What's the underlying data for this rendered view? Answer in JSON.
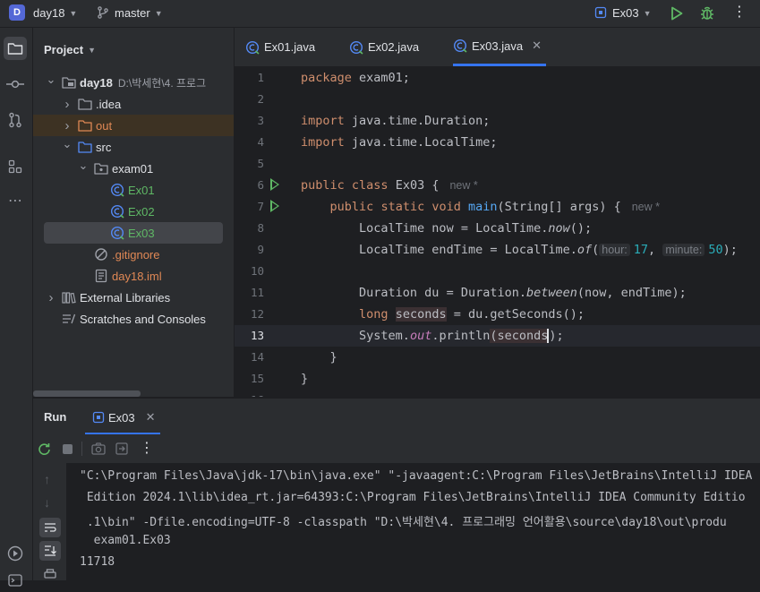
{
  "titlebar": {
    "project_badge": "D",
    "project_name": "day18",
    "branch": "master",
    "run_config": "Ex03"
  },
  "project_panel": {
    "title": "Project",
    "tree": [
      {
        "label": "day18",
        "suffix": "D:\\박세현\\4. 프로그",
        "icon": "module-folder-icon",
        "arrow": "down",
        "indent": 0
      },
      {
        "label": ".idea",
        "icon": "folder-icon",
        "arrow": "right",
        "indent": 1
      },
      {
        "label": "out",
        "icon": "folder-orange-icon",
        "arrow": "right",
        "indent": 1
      },
      {
        "label": "src",
        "icon": "source-folder-icon",
        "arrow": "down",
        "indent": 1
      },
      {
        "label": "exam01",
        "icon": "package-icon",
        "arrow": "down",
        "indent": 2
      },
      {
        "label": "Ex01",
        "icon": "java-class-icon",
        "arrow": "",
        "indent": 3
      },
      {
        "label": "Ex02",
        "icon": "java-class-icon",
        "arrow": "",
        "indent": 3
      },
      {
        "label": "Ex03",
        "icon": "java-class-icon",
        "arrow": "",
        "indent": 3
      },
      {
        "label": ".gitignore",
        "icon": "ignore-file-icon",
        "arrow": "",
        "indent": 2
      },
      {
        "label": "day18.iml",
        "icon": "iml-file-icon",
        "arrow": "",
        "indent": 2
      },
      {
        "label": "External Libraries",
        "icon": "library-icon",
        "arrow": "right",
        "indent": 0
      },
      {
        "label": "Scratches and Consoles",
        "icon": "scratches-icon",
        "arrow": "",
        "indent": 0
      }
    ]
  },
  "editor": {
    "tabs": [
      {
        "label": "Ex01.java",
        "active": false
      },
      {
        "label": "Ex02.java",
        "active": false
      },
      {
        "label": "Ex03.java",
        "active": true
      }
    ],
    "line_numbers": [
      "1",
      "2",
      "3",
      "4",
      "5",
      "6",
      "7",
      "8",
      "9",
      "10",
      "11",
      "12",
      "13",
      "14",
      "15",
      "16"
    ],
    "tokens": {
      "package_kw": "package",
      "package_name": " exam01;",
      "import_kw": "import",
      "import1": " java.time.Duration;",
      "import2": " java.time.LocalTime;",
      "public_kw": "public",
      "class_kw": "class",
      "class_name": "Ex03 {",
      "static_kw": "static",
      "void_kw": "void",
      "main_fn": "main",
      "main_params": "(String[] args) {",
      "new_marker": "new *",
      "line8_a": "LocalTime now = LocalTime.",
      "now_fn": "now",
      "line8_b": "();",
      "line9_a": "LocalTime endTime = LocalTime.",
      "of_fn": "of",
      "paren_open": "(",
      "hint_hour": "hour:",
      "hour_val": "17",
      "comma": ", ",
      "hint_minute": "minute:",
      "minute_val": "50",
      "line9_end": ");",
      "line11_a": "Duration du = Duration.",
      "between_fn": "between",
      "line11_b": "(now, endTime);",
      "long_kw": "long",
      "seconds_var": "seconds",
      "line12_b": " = du.getSeconds();",
      "line13_a": "System.",
      "out_field": "out",
      "line13_b": ".println",
      "line13_c": "(seconds",
      "line13_d": ");",
      "close_brace": "}"
    }
  },
  "run_panel": {
    "title": "Run",
    "tab": "Ex03",
    "output": [
      "\"C:\\Program Files\\Java\\jdk-17\\bin\\java.exe\" \"-javaagent:C:\\Program Files\\JetBrains\\IntelliJ IDEA",
      " Edition 2024.1\\lib\\idea_rt.jar=64393:C:\\Program Files\\JetBrains\\IntelliJ IDEA Community Editio",
      " .1\\bin\" -Dfile.encoding=UTF-8 -classpath \"D:\\박세현\\4. 프로그래밍 언어활용\\source\\day18\\out\\produ",
      "  exam01.Ex03",
      "11718"
    ]
  },
  "colors": {
    "accent": "#3574f0",
    "keyword": "#cf8e6d",
    "function": "#56a8f5",
    "number": "#2aacb8",
    "run_green": "#5fb865"
  }
}
